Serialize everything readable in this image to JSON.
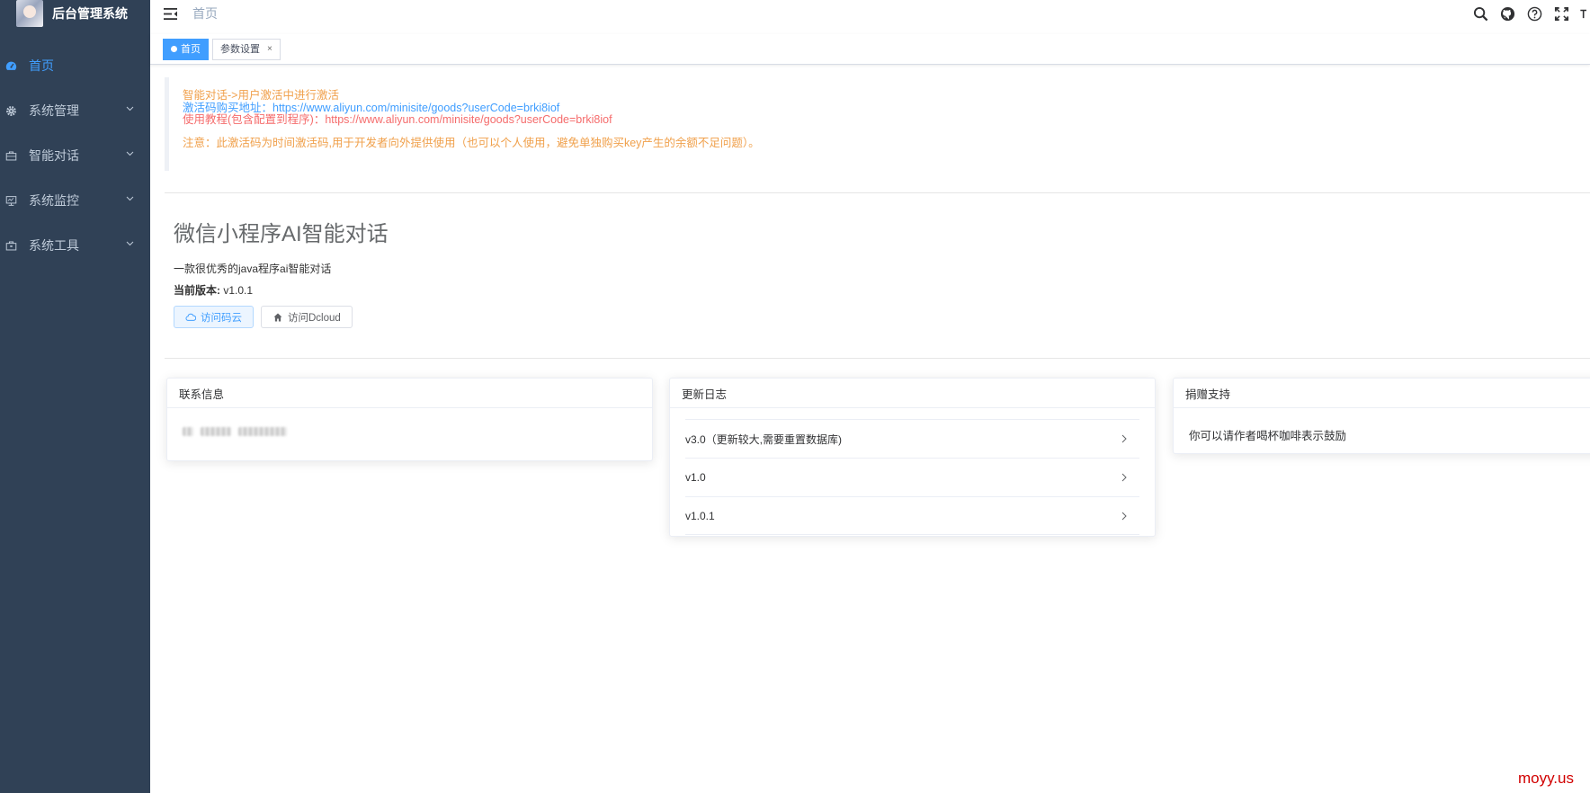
{
  "sidebar": {
    "logo_title": "后台管理系统",
    "items": [
      {
        "label": "首页",
        "icon": "dashboard-icon",
        "active": true
      },
      {
        "label": "系统管理",
        "icon": "gear-icon"
      },
      {
        "label": "智能对话",
        "icon": "briefcase-icon"
      },
      {
        "label": "系统监控",
        "icon": "monitor-icon"
      },
      {
        "label": "系统工具",
        "icon": "toolbox-icon"
      }
    ]
  },
  "navbar": {
    "breadcrumb": "首页",
    "icons": [
      "search-icon",
      "github-icon",
      "question-icon",
      "fullscreen-icon",
      "font-size-icon"
    ]
  },
  "tags": [
    {
      "label": "首页",
      "active": true
    },
    {
      "label": "参数设置",
      "close": "×"
    }
  ],
  "notice": {
    "line1": "智能对话->用户激活中进行激活",
    "line2": "激活码购买地址：https://www.aliyun.com/minisite/goods?userCode=brki8iof",
    "line3": "使用教程(包含配置到程序)：https://www.aliyun.com/minisite/goods?userCode=brki8iof",
    "line4": "注意：此激活码为时间激活码,用于开发者向外提供使用（也可以个人使用，避免单独购买key产生的余额不足问题）。"
  },
  "app": {
    "title": "微信小程序AI智能对话",
    "desc": "一款很优秀的java程序ai智能对话",
    "version_label": "当前版本:",
    "version_value": " v1.0.1",
    "btn_gitee": "访问码云",
    "btn_dcloud": "访问Dcloud"
  },
  "cards": {
    "contact": {
      "title": "联系信息"
    },
    "changelog": {
      "title": "更新日志",
      "items": [
        "v3.0（更新较大,需要重置数据库)",
        "v1.0",
        "v1.0.1"
      ]
    },
    "donate": {
      "title": "捐赠支持",
      "text": "你可以请作者喝杯咖啡表示鼓励"
    }
  },
  "watermark": "moyy.us",
  "colors": {
    "sidebar_bg": "#304156",
    "accent": "#409eff",
    "notice_orange": "#f0a04b",
    "notice_red": "#f56c6c"
  }
}
